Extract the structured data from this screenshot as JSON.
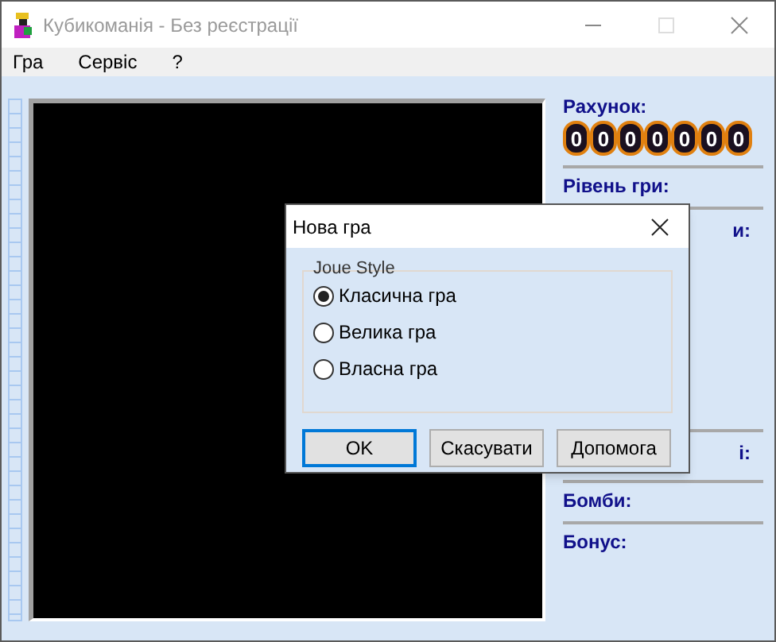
{
  "window": {
    "title": "Кубикоманія - Без реєстрації"
  },
  "menu": [
    "Гра",
    "Сервіс",
    "?"
  ],
  "side_panel": {
    "score_label": "Рахунок:",
    "score_digits": [
      "0",
      "0",
      "0",
      "0",
      "0",
      "0",
      "0"
    ],
    "sections": [
      {
        "label": "Рівень гри:",
        "kind": "full"
      },
      {
        "label": "и:",
        "kind": "cut"
      },
      {
        "label": "і:",
        "kind": "cut"
      },
      {
        "label": "Бомби:",
        "kind": "full"
      },
      {
        "label": "Бонус:",
        "kind": "full"
      }
    ]
  },
  "dialog": {
    "title": "Нова гра",
    "group": "Joue Style",
    "options": [
      {
        "label": "Класична гра",
        "selected": true
      },
      {
        "label": "Велика гра",
        "selected": false
      },
      {
        "label": "Власна гра",
        "selected": false
      }
    ],
    "buttons": [
      {
        "label": "OK",
        "default": true
      },
      {
        "label": "Скасувати",
        "default": false
      },
      {
        "label": "Допомога",
        "default": false
      }
    ]
  }
}
